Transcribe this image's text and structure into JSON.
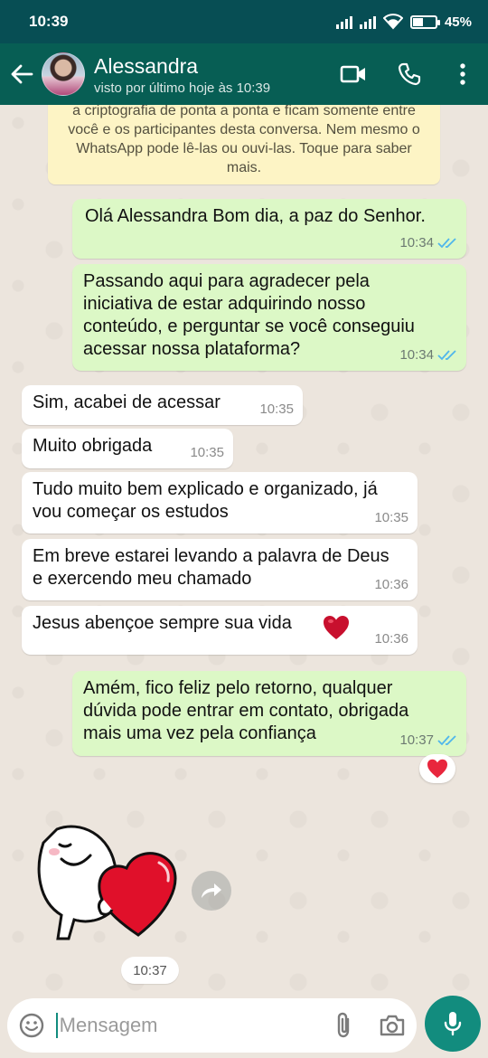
{
  "status_bar": {
    "time": "10:39",
    "battery": "45%",
    "battery_level": 0.45
  },
  "header": {
    "contact_name": "Alessandra",
    "last_seen": "visto por último hoje às 10:39",
    "icons": [
      "back-arrow-icon",
      "video-call-icon",
      "phone-icon",
      "more-vert-icon"
    ]
  },
  "encryption_notice": "a criptografia de ponta a ponta e ficam somente entre você e os participantes desta conversa. Nem mesmo o WhatsApp pode lê-las ou ouvi-las. Toque para saber mais.",
  "messages": [
    {
      "direction": "out",
      "text": "Olá Alessandra Bom dia, a paz do Senhor.",
      "time": "10:34",
      "status": "read"
    },
    {
      "direction": "out",
      "text": "Passando aqui para agradecer pela iniciativa de estar adquirindo nosso conteúdo, e perguntar se você conseguiu acessar nossa plataforma?",
      "time": "10:34",
      "status": "read"
    },
    {
      "direction": "in",
      "text": "Sim, acabei de acessar",
      "time": "10:35"
    },
    {
      "direction": "in",
      "text": "Muito obrigada",
      "time": "10:35"
    },
    {
      "direction": "in",
      "text": "Tudo muito bem explicado e organizado, já vou começar os estudos",
      "time": "10:35"
    },
    {
      "direction": "in",
      "text": "Em breve estarei levando a palavra de Deus e exercendo meu chamado",
      "time": "10:36"
    },
    {
      "direction": "in",
      "text": "Jesus abençoe sempre sua vida",
      "emoji": "heart",
      "time": "10:36"
    },
    {
      "direction": "out",
      "text": "Amém, fico feliz pelo retorno, qualquer dúvida pode entrar em contato, obrigada mais uma vez pela confiança",
      "time": "10:37",
      "status": "read",
      "reaction": "heart"
    },
    {
      "direction": "in",
      "type": "sticker",
      "sticker": "smiling-face-hugging-heart",
      "time": "10:37"
    }
  ],
  "input": {
    "placeholder": "Mensagem",
    "value": ""
  },
  "colors": {
    "header": "#075e54",
    "outgoing": "#dcf8c6",
    "incoming": "#ffffff",
    "tick_read": "#4fb6ec",
    "accent": "#128c7e"
  }
}
